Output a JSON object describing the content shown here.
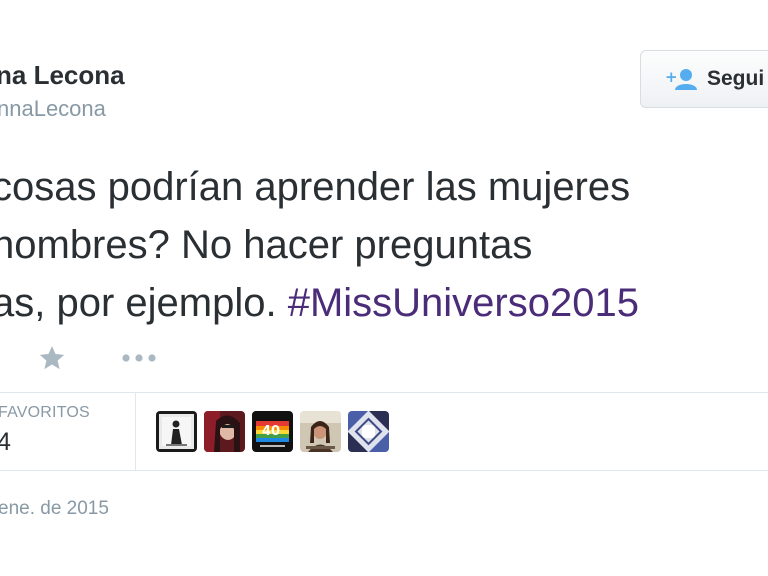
{
  "author": {
    "display_name": "na Lecona",
    "handle": "nnaLecona"
  },
  "follow_button": {
    "label": "Segui",
    "icon": "follow-user-plus-icon"
  },
  "tweet": {
    "lines": [
      "cosas podrían aprender las mujeres",
      "hombres? No hacer preguntas",
      "as, por ejemplo. "
    ],
    "hashtag": "#MissUniverso2015",
    "hashtag_color": "#4a2c78"
  },
  "actions": {
    "favorite_icon": "star-icon",
    "more_icon": "more-dots-icon"
  },
  "stats": {
    "favorites_label": "FAVORITOS",
    "favorites_count": "4"
  },
  "favorited_by": [
    {
      "name": "avatar-1"
    },
    {
      "name": "avatar-2"
    },
    {
      "name": "avatar-3"
    },
    {
      "name": "avatar-4"
    },
    {
      "name": "avatar-5"
    }
  ],
  "timestamp": "ene. de 2015",
  "colors": {
    "text": "#292f33",
    "muted": "#8899a6",
    "accent": "#55acee"
  }
}
